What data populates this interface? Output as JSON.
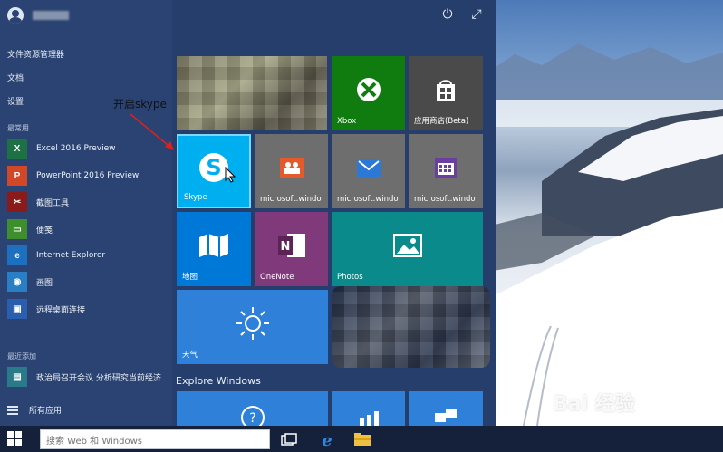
{
  "user": {
    "name": ""
  },
  "left_links": [
    {
      "label": "文件资源管理器"
    },
    {
      "label": "文档"
    },
    {
      "label": "设置"
    }
  ],
  "most_used": {
    "label": "最常用",
    "apps": [
      {
        "label": "Excel 2016 Preview",
        "icon": "excel-icon",
        "color": "#1e7145"
      },
      {
        "label": "PowerPoint 2016 Preview",
        "icon": "powerpoint-icon",
        "color": "#d24726"
      },
      {
        "label": "截图工具",
        "icon": "snipping-tool-icon",
        "color": "#8b1a1a"
      },
      {
        "label": "便笺",
        "icon": "sticky-notes-icon",
        "color": "#3e8e2e"
      },
      {
        "label": "Internet Explorer",
        "icon": "ie-icon",
        "color": "#1d6fbf"
      },
      {
        "label": "画图",
        "icon": "paint-icon",
        "color": "#2a7fc4"
      },
      {
        "label": "远程桌面连接",
        "icon": "remote-desktop-icon",
        "color": "#2a5fb0"
      }
    ]
  },
  "recently_added": {
    "label": "最近添加",
    "apps": [
      {
        "label": "政治局召开会议 分析研究当前经济",
        "icon": "news-icon",
        "color": "#2a7a8a"
      }
    ]
  },
  "all_apps_label": "所有应用",
  "annotation": "开启skype",
  "tiles": [
    {
      "id": "xbox",
      "label": "Xbox",
      "color": "#107c10"
    },
    {
      "id": "store",
      "label": "应用商店(Beta)",
      "color": "#4a4a4a"
    },
    {
      "id": "skype",
      "label": "Skype",
      "color": "#00aff0"
    },
    {
      "id": "people",
      "label": "microsoft.windo",
      "color": "#6e6e6e"
    },
    {
      "id": "mail",
      "label": "microsoft.windo",
      "color": "#6e6e6e"
    },
    {
      "id": "calendar",
      "label": "microsoft.windo",
      "color": "#6e6e6e"
    },
    {
      "id": "maps",
      "label": "地图",
      "color": "#0078d7"
    },
    {
      "id": "onenote",
      "label": "OneNote",
      "color": "#80397b"
    },
    {
      "id": "photos",
      "label": "Photos",
      "color": "#0a8a8a"
    },
    {
      "id": "weather",
      "label": "天气",
      "color": "#2e80d9"
    }
  ],
  "group_title": "Explore Windows",
  "taskbar": {
    "search_placeholder": "搜索 Web 和 Windows"
  },
  "watermark": {
    "text": "Bai 经验",
    "url": "jingyan.baidu.com"
  }
}
